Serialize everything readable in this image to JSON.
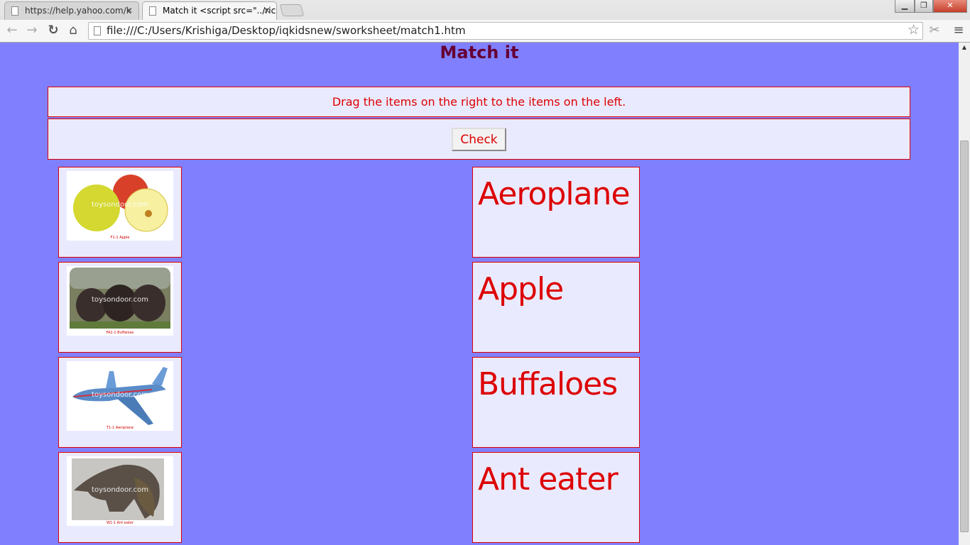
{
  "browser": {
    "tabs": [
      {
        "label": "https://help.yahoo.com/k",
        "active": false
      },
      {
        "label": "Match it <script src=\"../ric",
        "active": true
      }
    ],
    "url": "file:///C:/Users/Krishiga/Desktop/iqkidsnew/sworksheet/match1.htm"
  },
  "page": {
    "title": "Match it",
    "instruction": "Drag the items on the right to the items on the left.",
    "check_label": "Check",
    "left_items": [
      {
        "picture": "apple",
        "watermark": "toysondoor.com",
        "caption": "F1-1 Apple"
      },
      {
        "picture": "buffaloes",
        "watermark": "toysondoor.com",
        "caption": "FA1-1 Buffaloes"
      },
      {
        "picture": "aeroplane",
        "watermark": "toysondoor.com",
        "caption": "T1-1 Aeroplane"
      },
      {
        "picture": "ant-eater",
        "watermark": "toysondoor.com",
        "caption": "W1-1 Ant eater"
      }
    ],
    "right_items": [
      "Aeroplane",
      "Apple",
      "Buffaloes",
      "Ant eater"
    ]
  },
  "colors": {
    "background": "#8080ff",
    "panel": "#eaeaff",
    "accent": "#dd0000",
    "title": "#660033"
  }
}
